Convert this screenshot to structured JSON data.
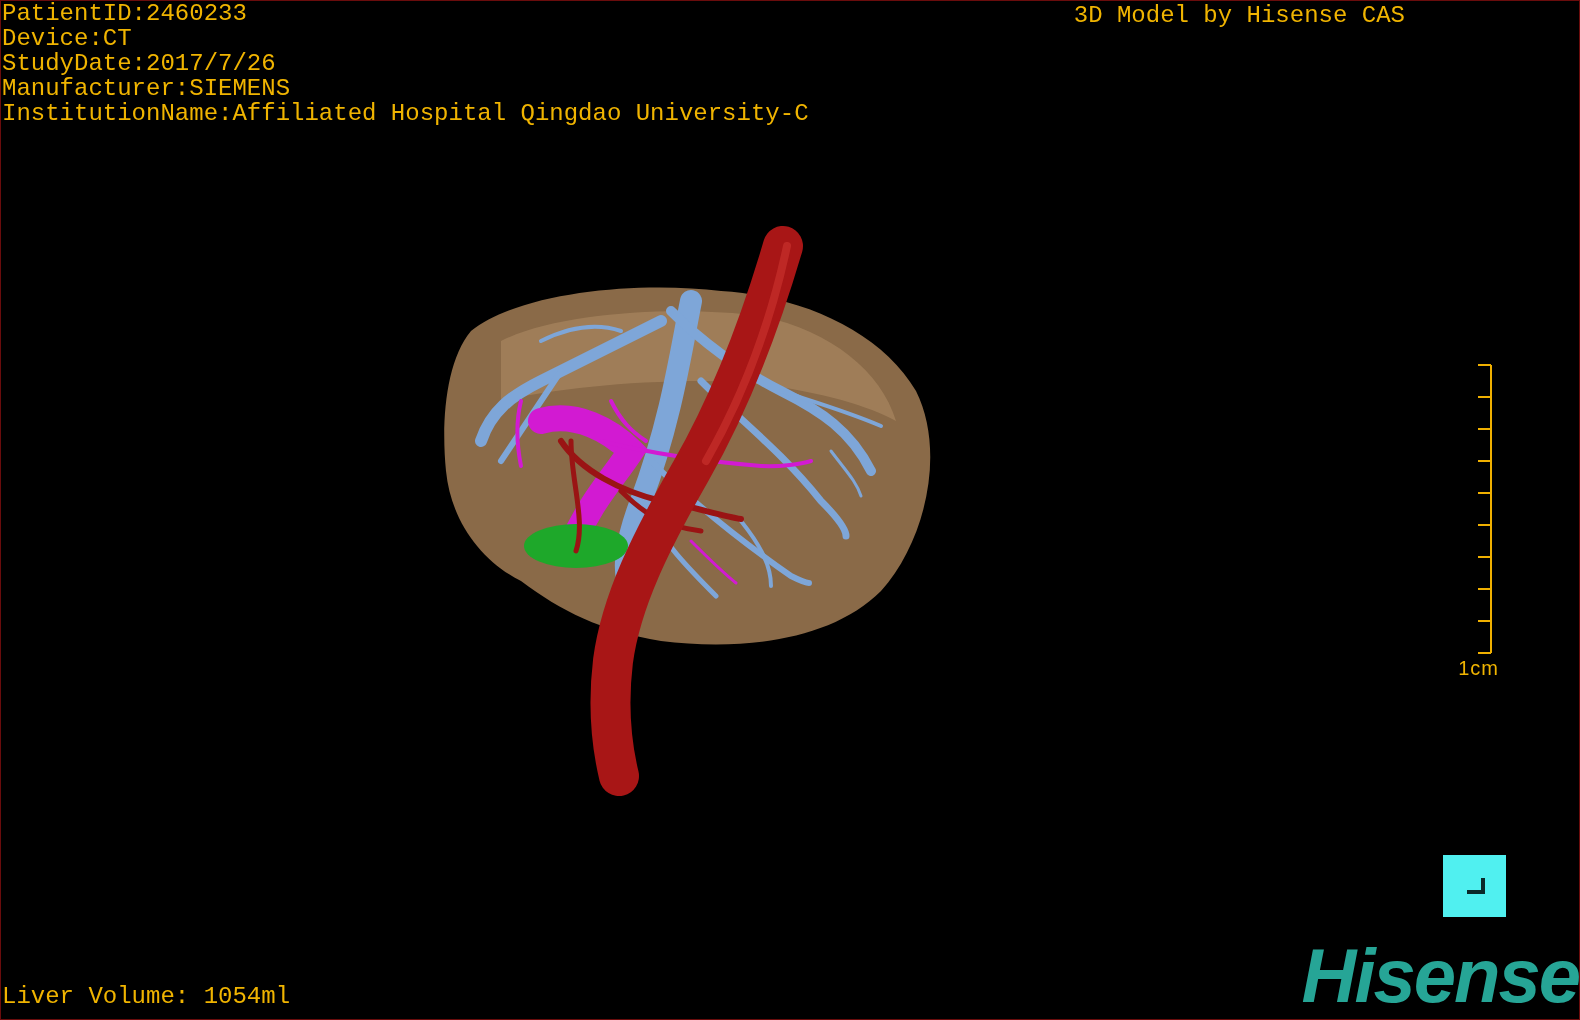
{
  "patient_info": [
    "PatientID:2460233",
    "Device:CT",
    "StudyDate:2017/7/26",
    "Manufacturer:SIEMENS",
    "InstitutionName:Affiliated Hospital Qingdao University-C"
  ],
  "title": "3D Model by Hisense CAS",
  "scale_bar": {
    "label": "1cm"
  },
  "liver_volume": "Liver Volume: 1054ml",
  "logo": "Hisense"
}
